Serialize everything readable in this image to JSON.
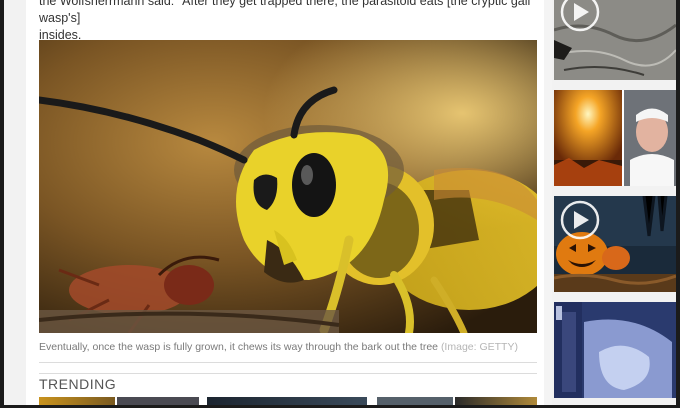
{
  "article": {
    "text_line1": "the Wolfsherrmann said: \"After they get trapped there, the parasitoid eats [the cryptic gall wasp's]",
    "text_line2": "insides.",
    "image_caption": "Eventually, once the wasp is fully grown, it chews its way through the bark out the tree",
    "image_credit": "(Image: GETTY)"
  },
  "trending": {
    "heading": "TRENDING"
  },
  "sidebar": {
    "thumbnails": [
      {
        "subject": "cave wall with worms",
        "has_video": true
      },
      {
        "subject": "apocalyptic light and pope",
        "has_video": false
      },
      {
        "subject": "halloween pumpkins",
        "has_video": true
      },
      {
        "subject": "night vision camera",
        "has_video": false
      }
    ]
  },
  "icons": {
    "play": "play-icon"
  }
}
